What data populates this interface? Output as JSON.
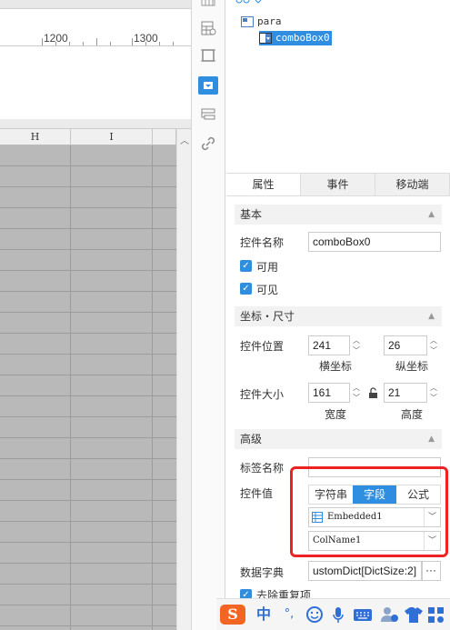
{
  "ruler": {
    "labels": [
      "1200",
      "1300"
    ]
  },
  "sheet": {
    "columns": [
      "H",
      "I"
    ]
  },
  "toolbar": {
    "icons": [
      "report-cell-icon",
      "frame-icon",
      "combobox-widget-icon",
      "layout-icon",
      "link-icon"
    ]
  },
  "tree": {
    "root": "para",
    "child": "comboBox0"
  },
  "tabs": [
    "属性",
    "事件",
    "移动端"
  ],
  "basic": {
    "title": "基本",
    "name_label": "控件名称",
    "name_value": "comboBox0",
    "enabled_label": "可用",
    "visible_label": "可见"
  },
  "coords": {
    "title": "坐标・尺寸",
    "pos_label": "控件位置",
    "x": "241",
    "y": "26",
    "x_label": "横坐标",
    "y_label": "纵坐标",
    "size_label": "控件大小",
    "width": "161",
    "height": "21",
    "width_label": "宽度",
    "height_label": "高度"
  },
  "advanced": {
    "title": "高级",
    "tag_label": "标签名称",
    "tag_value": "",
    "value_label": "控件值",
    "value_modes": [
      "字符串",
      "字段",
      "公式"
    ],
    "active_mode": "字段",
    "dataset": "Embedded1",
    "column": "ColName1",
    "dict_label": "数据字典",
    "dict_value": "ustomDict[DictSize:2]",
    "dict_more": "···",
    "dedupe_label": "去除重复项"
  },
  "ime": {
    "logo": "S",
    "mode": "中",
    "punct": "°,"
  },
  "colors": {
    "accent": "#2f8ee0",
    "highlight": "#ee2222",
    "sogou": "#f26522"
  }
}
